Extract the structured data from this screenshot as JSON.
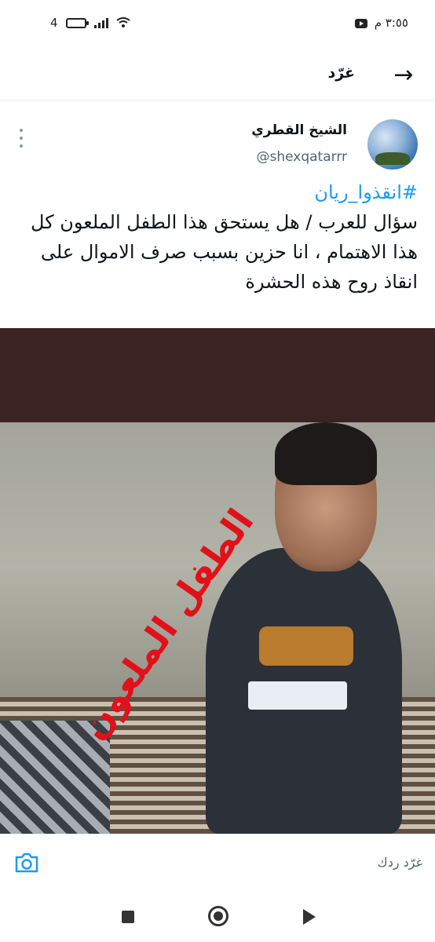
{
  "status_bar": {
    "time": "٣:٥٥ م",
    "battery_level": "4",
    "network_label": "4",
    "icons": [
      "youtube-icon",
      "battery-icon",
      "signal-icon",
      "wifi-icon"
    ]
  },
  "header": {
    "title": "غرّد",
    "back_icon": "arrow-right-icon"
  },
  "tweet": {
    "author_name": "الشيخ القطري",
    "author_handle": "@shexqatarrr",
    "hashtag": "#انقذوا_ريان",
    "body": "سؤال للعرب / هل يستحق هذا الطفل الملعون كل هذا الاهتمام ، انا حزين بسبب صرف الاموال على انقاذ روح هذه الحشرة",
    "media_overlay_text": "الطفل الملعون"
  },
  "reply_bar": {
    "placeholder": "غرّد ردك",
    "camera_icon": "camera-icon"
  },
  "colors": {
    "hashtag": "#1d9bf0",
    "handle": "#536471",
    "overlay": "#e2101a"
  }
}
